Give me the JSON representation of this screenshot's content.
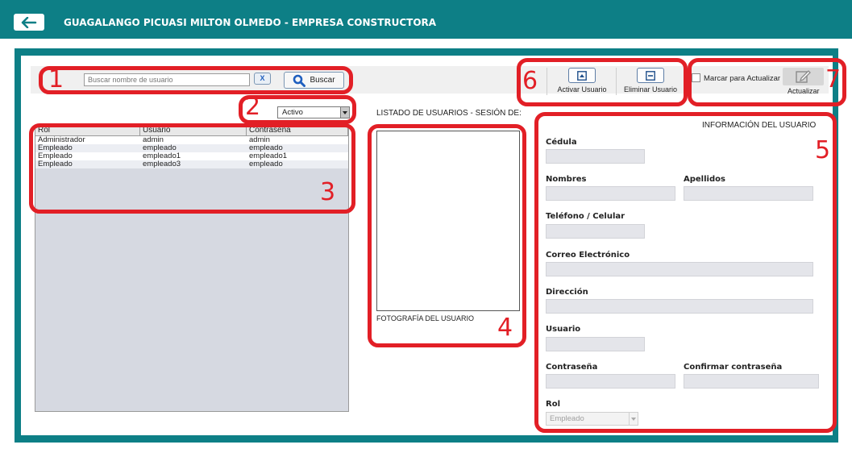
{
  "header": {
    "title": "GUAGALANGO PICUASI MILTON OLMEDO - EMPRESA CONSTRUCTORA"
  },
  "colors": {
    "topbar": "#0d7f86",
    "callout": "#e21f26",
    "field_bg": "#e4e5ea"
  },
  "search": {
    "placeholder": "Buscar nombre de usuario",
    "clear_label": "X",
    "button_label": "Buscar"
  },
  "filter": {
    "status_selected": "Activo"
  },
  "table": {
    "headers": [
      "Rol",
      "Usuario",
      "Contraseña"
    ],
    "rows": [
      [
        "Administrador",
        "admin",
        "admin"
      ],
      [
        "Empleado",
        "empleado",
        "empleado"
      ],
      [
        "Empleado",
        "empleado1",
        "empleado1"
      ],
      [
        "Empleado",
        "empleado3",
        "empleado"
      ]
    ]
  },
  "list": {
    "title": "LISTADO DE USUARIOS - SESIÓN DE:"
  },
  "photo": {
    "label": "FOTOGRAFÍA DEL USUARIO"
  },
  "toolbar": {
    "activate_label": "Activar Usuario",
    "delete_label": "Eliminar Usuario",
    "mark_label": "Marcar para Actualizar",
    "update_label": "Actualizar"
  },
  "info": {
    "title": "INFORMACIÓN DEL USUARIO",
    "cedula": "Cédula",
    "nombres": "Nombres",
    "apellidos": "Apellidos",
    "telefono": "Teléfono / Celular",
    "correo": "Correo Electrónico",
    "direccion": "Dirección",
    "usuario": "Usuario",
    "contrasena": "Contraseña",
    "confirmar": "Confirmar contraseña",
    "rol": "Rol",
    "rol_value": "Empleado"
  },
  "annotations": [
    "1",
    "2",
    "3",
    "4",
    "5",
    "6",
    "7"
  ]
}
